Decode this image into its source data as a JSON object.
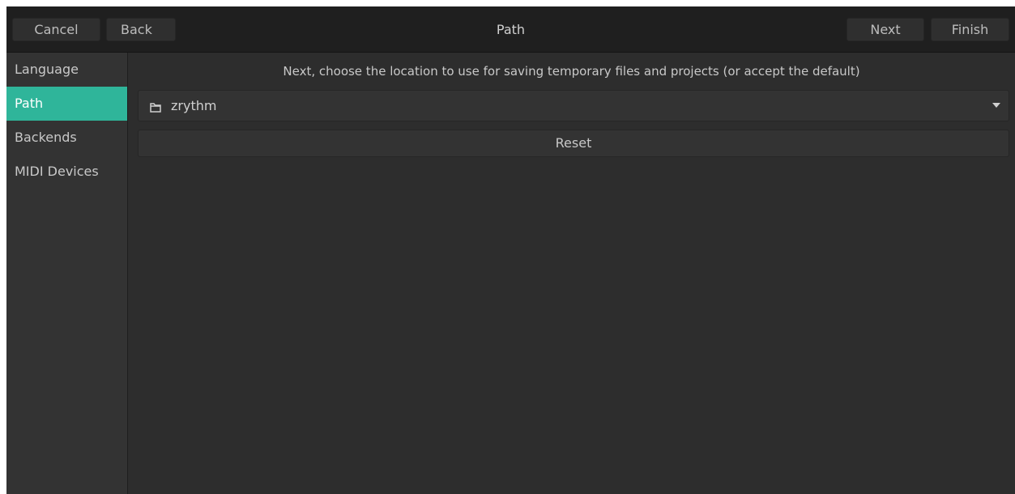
{
  "header": {
    "title": "Path",
    "cancel_label": "Cancel",
    "back_label": "Back",
    "next_label": "Next",
    "finish_label": "Finish"
  },
  "sidebar": {
    "items": [
      {
        "label": "Language",
        "active": false
      },
      {
        "label": "Path",
        "active": true
      },
      {
        "label": "Backends",
        "active": false
      },
      {
        "label": "MIDI Devices",
        "active": false
      }
    ]
  },
  "main": {
    "instruction": "Next, choose the  location to use for saving temporary files and projects (or accept the default)",
    "path_chooser": {
      "value": "zrythm",
      "icon": "folder-icon",
      "dropdown_icon": "chevron-down-icon"
    },
    "reset_label": "Reset"
  },
  "colors": {
    "accent": "#2fb59a",
    "background": "#2d2d2d",
    "headerbar": "#1f1f1f",
    "sidebar": "#333333",
    "text": "#c8c8c8"
  }
}
